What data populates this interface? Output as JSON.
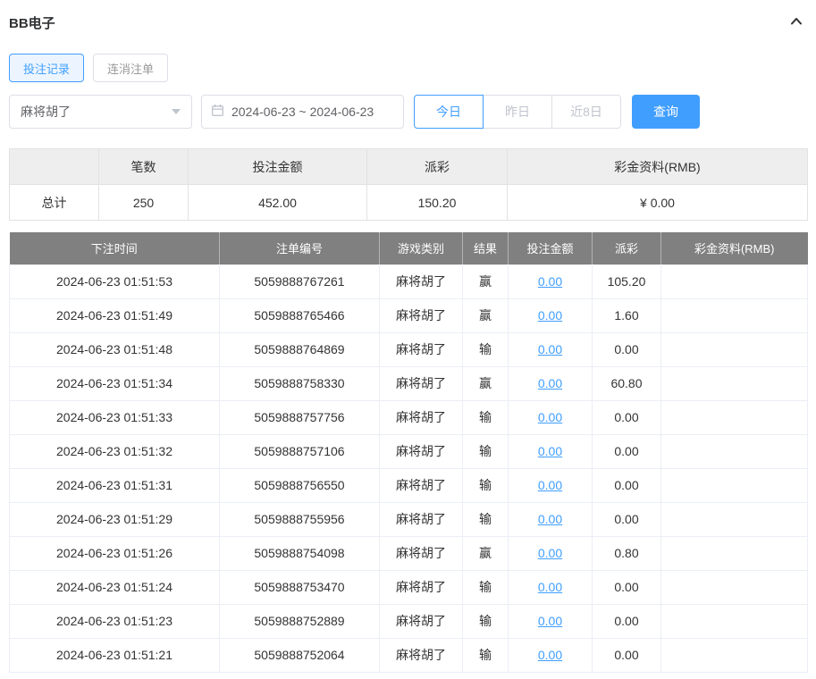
{
  "panel": {
    "title": "BB电子"
  },
  "tabs": {
    "records_label": "投注记录",
    "linked_label": "连消注单"
  },
  "filters": {
    "game_select_value": "麻将胡了",
    "date_range_value": "2024-06-23 ~ 2024-06-23",
    "today_label": "今日",
    "yesterday_label": "昨日",
    "last8days_label": "近8日",
    "search_label": "查询"
  },
  "summary": {
    "headers": {
      "count": "笔数",
      "bet": "投注金额",
      "payout": "派彩",
      "bonus": "彩金资料(RMB)"
    },
    "total_label": "总计",
    "count": "250",
    "bet": "452.00",
    "payout": "150.20",
    "bonus": "¥ 0.00"
  },
  "table": {
    "headers": [
      "下注时间",
      "注单编号",
      "游戏类别",
      "结果",
      "投注金额",
      "派彩",
      "彩金资料(RMB)"
    ],
    "rows": [
      {
        "time": "2024-06-23 01:51:53",
        "order_no": "5059888767261",
        "game": "麻将胡了",
        "result": "赢",
        "bet": "0.00",
        "payout": "105.20",
        "bonus": ""
      },
      {
        "time": "2024-06-23 01:51:49",
        "order_no": "5059888765466",
        "game": "麻将胡了",
        "result": "赢",
        "bet": "0.00",
        "payout": "1.60",
        "bonus": ""
      },
      {
        "time": "2024-06-23 01:51:48",
        "order_no": "5059888764869",
        "game": "麻将胡了",
        "result": "输",
        "bet": "0.00",
        "payout": "0.00",
        "bonus": ""
      },
      {
        "time": "2024-06-23 01:51:34",
        "order_no": "5059888758330",
        "game": "麻将胡了",
        "result": "赢",
        "bet": "0.00",
        "payout": "60.80",
        "bonus": ""
      },
      {
        "time": "2024-06-23 01:51:33",
        "order_no": "5059888757756",
        "game": "麻将胡了",
        "result": "输",
        "bet": "0.00",
        "payout": "0.00",
        "bonus": ""
      },
      {
        "time": "2024-06-23 01:51:32",
        "order_no": "5059888757106",
        "game": "麻将胡了",
        "result": "输",
        "bet": "0.00",
        "payout": "0.00",
        "bonus": ""
      },
      {
        "time": "2024-06-23 01:51:31",
        "order_no": "5059888756550",
        "game": "麻将胡了",
        "result": "输",
        "bet": "0.00",
        "payout": "0.00",
        "bonus": ""
      },
      {
        "time": "2024-06-23 01:51:29",
        "order_no": "5059888755956",
        "game": "麻将胡了",
        "result": "输",
        "bet": "0.00",
        "payout": "0.00",
        "bonus": ""
      },
      {
        "time": "2024-06-23 01:51:26",
        "order_no": "5059888754098",
        "game": "麻将胡了",
        "result": "赢",
        "bet": "0.00",
        "payout": "0.80",
        "bonus": ""
      },
      {
        "time": "2024-06-23 01:51:24",
        "order_no": "5059888753470",
        "game": "麻将胡了",
        "result": "输",
        "bet": "0.00",
        "payout": "0.00",
        "bonus": ""
      },
      {
        "time": "2024-06-23 01:51:23",
        "order_no": "5059888752889",
        "game": "麻将胡了",
        "result": "输",
        "bet": "0.00",
        "payout": "0.00",
        "bonus": ""
      },
      {
        "time": "2024-06-23 01:51:21",
        "order_no": "5059888752064",
        "game": "麻将胡了",
        "result": "输",
        "bet": "0.00",
        "payout": "0.00",
        "bonus": ""
      }
    ]
  },
  "colors": {
    "accent": "#409eff",
    "table_header_bg": "#808080",
    "summary_header_bg": "#eeeeee"
  }
}
